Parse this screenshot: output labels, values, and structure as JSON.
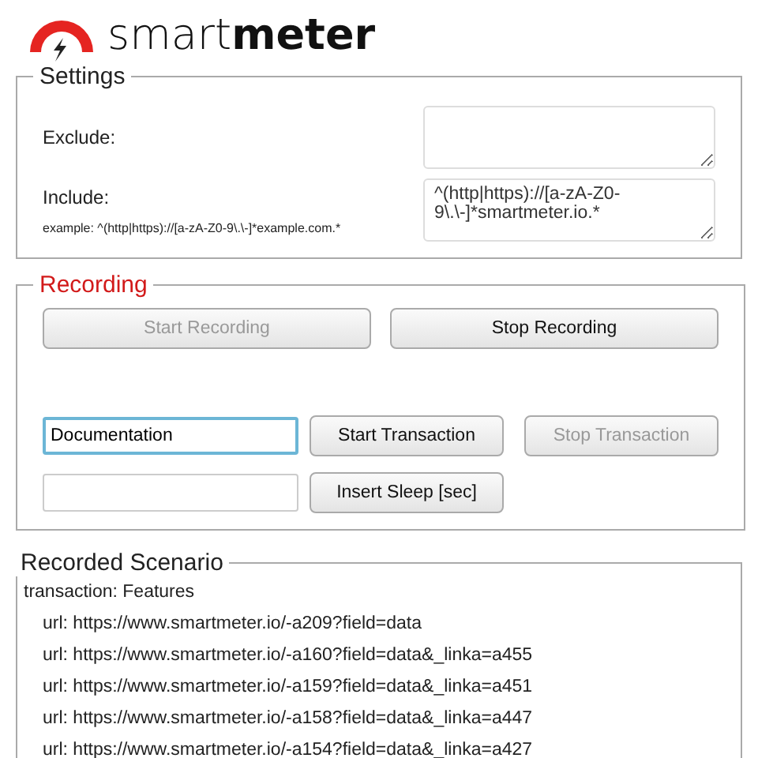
{
  "logo": {
    "text": "smart**meter**"
  },
  "settings": {
    "legend": "Settings",
    "exclude": {
      "label": "Exclude:"
    },
    "include": {
      "label": "Include:",
      "hint": "example: ^(http|https)://[a-zA-Z0-9\\.\\-]*example.com.*",
      "value": "^(http|https)://[a-zA-Z0-9\\.\\-]*smartmeter.io.*"
    }
  },
  "recording": {
    "legend": "Recording",
    "buttons": [
      {
        "label": "Start Recording",
        "disabled": true
      },
      {
        "label": "Stop Recording",
        "disabled": false
      }
    ],
    "transaction_field": {
      "value": "Documentation"
    },
    "transaction_buttons": [
      {
        "label": "Start Transaction",
        "disabled": false
      },
      {
        "label": "Stop Transaction",
        "disabled": true
      }
    ],
    "sleep_button": {
      "label": "Insert Sleep [sec]",
      "disabled": false
    }
  },
  "scenario": {
    "legend": "Recorded Scenario",
    "items": [
      {
        "text": "transaction: Features",
        "children": [
          {
            "text": "url: https://www.smartmeter.io/-a209?field=data"
          },
          {
            "text": "url: https://www.smartmeter.io/-a160?field=data&_linka=a455"
          },
          {
            "text": "url: https://www.smartmeter.io/-a159?field=data&_linka=a451"
          },
          {
            "text": "url: https://www.smartmeter.io/-a158?field=data&_linka=a447"
          },
          {
            "text": "url: https://www.smartmeter.io/-a154?field=data&_linka=a427"
          }
        ]
      }
    ]
  }
}
